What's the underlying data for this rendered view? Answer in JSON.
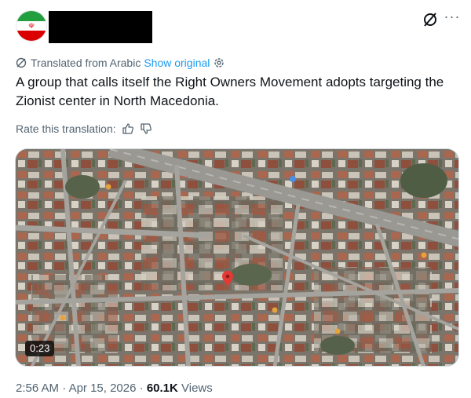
{
  "post": {
    "avatar": "iran-flag",
    "translation": {
      "notice": "Translated from Arabic",
      "show_original": "Show original"
    },
    "text": "A group that calls itself the Right Owners Movement adopts targeting the Zionist center in North Macedonia.",
    "rate_label": "Rate this translation:",
    "video": {
      "duration": "0:23"
    },
    "time": "2:56 AM",
    "separator": "·",
    "date": "Apr 15, 2026",
    "views_count": "60.1K",
    "views_label": "Views"
  },
  "colors": {
    "link": "#1d9bf0",
    "secondary": "#536471",
    "text": "#0f1419"
  },
  "icons": [
    "grok-icon",
    "more-icon",
    "translate-icon",
    "settings-icon",
    "thumbs-up-icon",
    "thumbs-down-icon",
    "location-pin-icon"
  ]
}
